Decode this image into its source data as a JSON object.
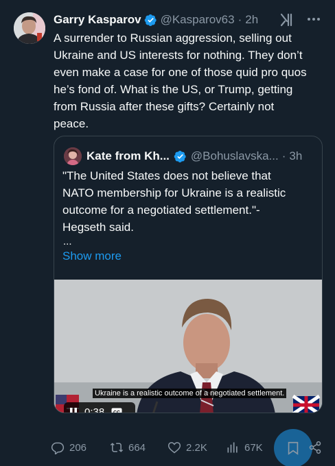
{
  "tweet": {
    "author_name": "Garry Kasparov",
    "handle": "@Kasparov63",
    "separator": "·",
    "time": "2h",
    "text": "A surrender to Russian aggression, selling out\nUkraine and US interests for nothing. They don’t\neven make a case for one of those quid pro quos\nhe’s fond of. What is the US, or Trump, getting\nfrom Russia after these gifts? Certainly not\npeace."
  },
  "quote": {
    "author_name": "Kate from Kh...",
    "handle": "@Bohuslavska...",
    "separator": "·",
    "time": "3h",
    "text": "\"The United States does not believe that\nNATO membership for Ukraine is a realistic\noutcome for a negotiated settlement.\"-\nHegseth said.",
    "ellipsis": "...",
    "show_more": "Show more",
    "video": {
      "caption": "Ukraine is a realistic outcome of a negotiated settlement.",
      "time": "0:38",
      "cc_label": "CC"
    }
  },
  "actions": {
    "replies": "206",
    "reposts": "664",
    "likes": "2.2K",
    "views": "67K"
  },
  "colors": {
    "background": "#15202b",
    "text": "#f7f9f9",
    "secondary": "#8b98a5",
    "accent": "#1d9bf0",
    "border": "#38444d"
  },
  "icons": [
    "verified-badge-icon",
    "grok-icon",
    "more-icon",
    "pause-icon",
    "cc-icon",
    "reply-icon",
    "repost-icon",
    "like-icon",
    "views-icon",
    "bookmark-icon",
    "share-icon"
  ]
}
